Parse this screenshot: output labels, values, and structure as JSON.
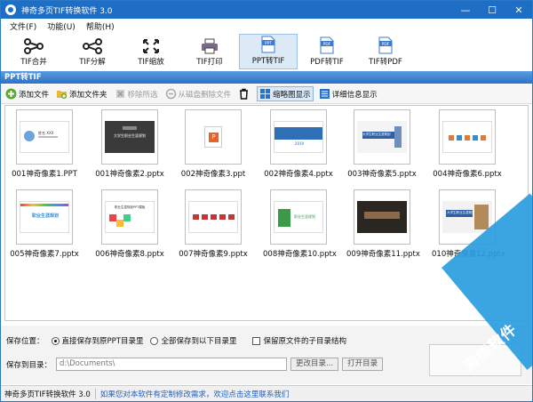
{
  "window": {
    "title": "神奇多页TIF转换软件 3.0",
    "minimize": "—",
    "maximize": "☐",
    "close": "✕"
  },
  "menu": [
    {
      "label": "文件(F)"
    },
    {
      "label": "功能(U)"
    },
    {
      "label": "帮助(H)"
    }
  ],
  "toolbar": [
    {
      "label": "TIF合并",
      "icon": "merge-icon"
    },
    {
      "label": "TIF分解",
      "icon": "split-icon"
    },
    {
      "label": "TIF缩放",
      "icon": "resize-icon"
    },
    {
      "label": "TIF打印",
      "icon": "printer-icon"
    },
    {
      "label": "PPT转TIF",
      "icon": "ppt-file-icon",
      "badge": "PPT",
      "active": true
    },
    {
      "label": "PDF转TIF",
      "icon": "pdf-file-icon",
      "badge": "PDF"
    },
    {
      "label": "TIF转PDF",
      "icon": "pdf-file-icon",
      "badge": "PDF"
    }
  ],
  "section_title": "PPT转TIF",
  "actions": {
    "add_file": "添加文件",
    "add_folder": "添加文件夹",
    "remove_selected": "移除所选",
    "delete_from_disk": "从磁盘删除文件",
    "thumbnail_view": "缩略图显示",
    "detail_view": "详细信息显示"
  },
  "files": [
    {
      "name": "001神奇像素1.PPT",
      "style": "profile",
      "caption": "姓名 XXX"
    },
    {
      "name": "001神奇像素2.pptx",
      "style": "dark",
      "caption": "大学生职业生涯规划"
    },
    {
      "name": "002神奇像素3.ppt",
      "style": "fileicon",
      "caption": ""
    },
    {
      "name": "002神奇像素4.pptx",
      "style": "blue-banner",
      "caption": "2019"
    },
    {
      "name": "003神奇像素5.pptx",
      "style": "blue-title",
      "caption": "大学生职业生涯规划"
    },
    {
      "name": "004神奇像素6.pptx",
      "style": "steps",
      "caption": ""
    },
    {
      "name": "005神奇像素7.pptx",
      "style": "colorful",
      "caption": "职业生涯规划"
    },
    {
      "name": "006神奇像素8.pptx",
      "style": "cubes",
      "caption": "职业生涯规划PPT模板"
    },
    {
      "name": "007神奇像素9.pptx",
      "style": "red-steps",
      "caption": ""
    },
    {
      "name": "008神奇像素10.pptx",
      "style": "green",
      "caption": "职业生涯规划"
    },
    {
      "name": "009神奇像素11.pptx",
      "style": "dark-wood",
      "caption": ""
    },
    {
      "name": "010神奇像素12.pptx",
      "style": "building",
      "caption": "大学生职业生涯规划"
    }
  ],
  "save": {
    "location_label": "保存位置：",
    "option_same_dir": "直接保存到原PPT目录里",
    "option_custom_dir": "全部保存到以下目录里",
    "keep_structure": "保留原文件的子目录结构",
    "dir_label": "保存到目录：",
    "dir_value": "d:\\Documents\\",
    "change_dir": "更改目录...",
    "open_dir": "打开目录"
  },
  "status": {
    "app": "神奇多页TIF转换软件 3.0",
    "message": "如果您对本软件有定制修改需求，欢迎点击这里联系我们"
  },
  "colors": {
    "titlebar": "#1f6ec5",
    "accent": "#2c73c7",
    "watermark": "#2a9de0"
  },
  "watermark": "海绵软件"
}
